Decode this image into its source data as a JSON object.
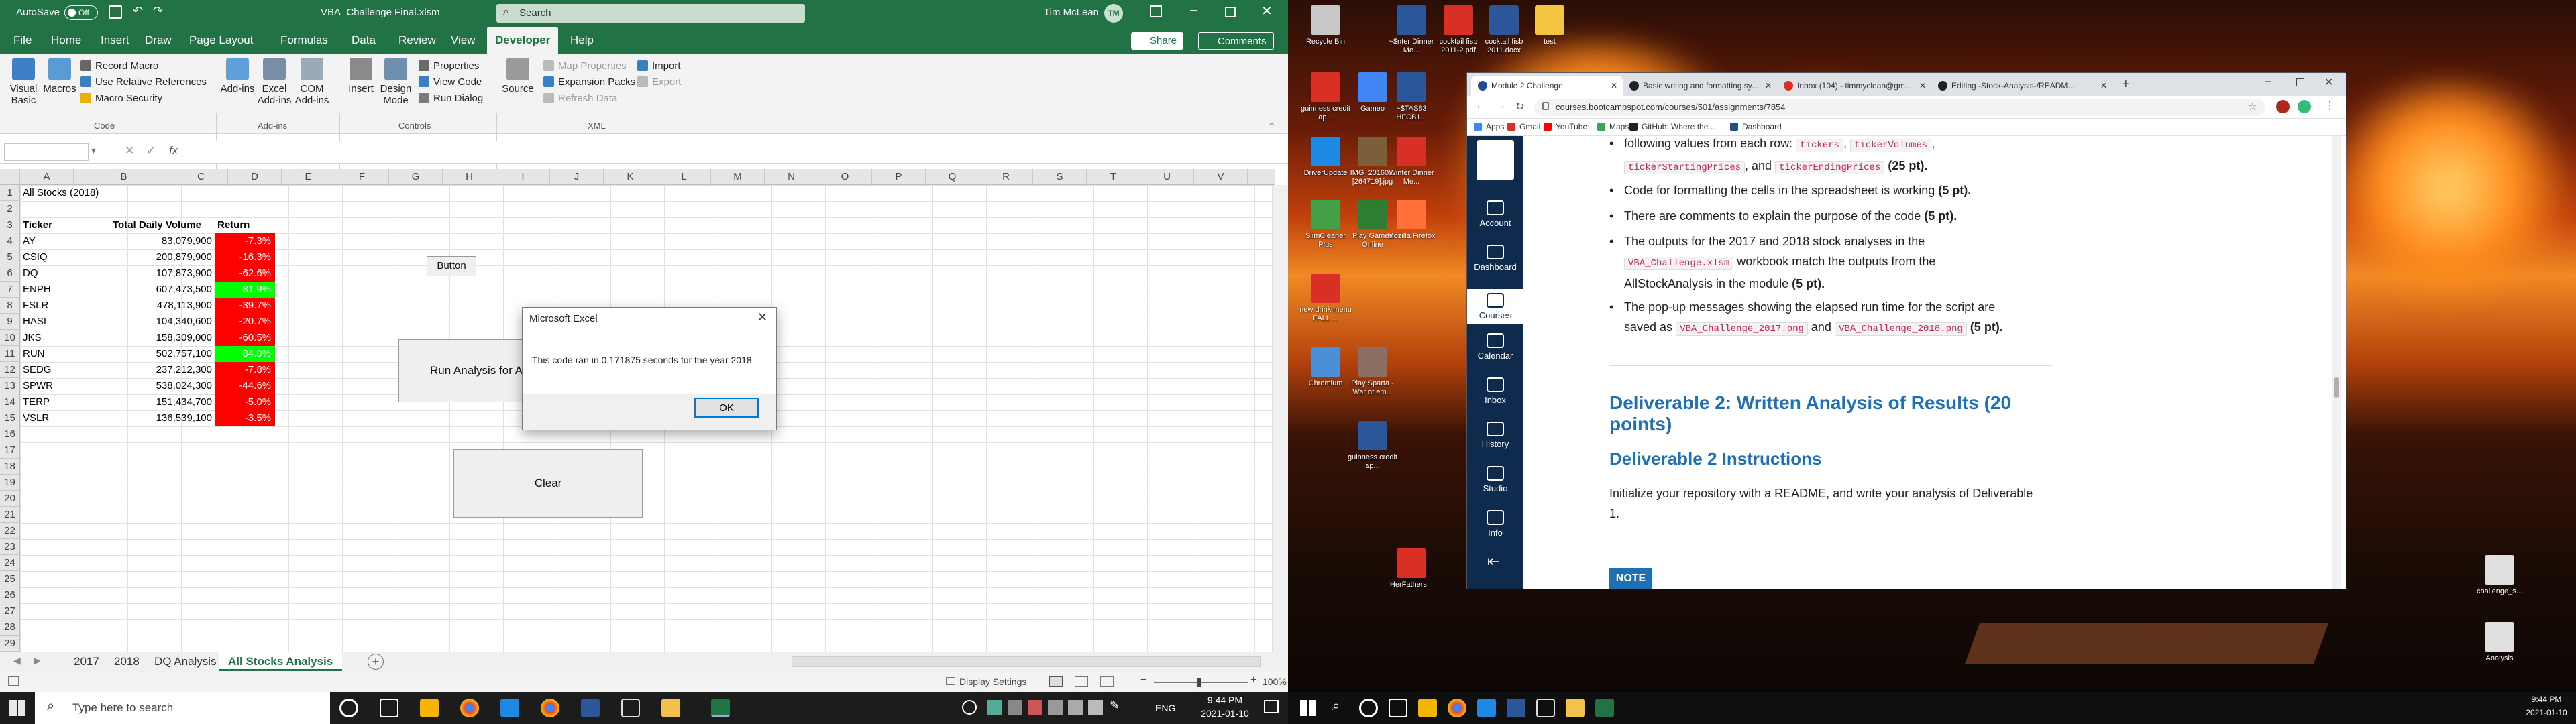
{
  "excel": {
    "autosave_label": "AutoSave",
    "autosave_state": "Off",
    "filename": "VBA_Challenge Final.xlsm",
    "search_placeholder": "Search",
    "user_name": "Tim McLean",
    "user_initials": "TM",
    "tabs": [
      "File",
      "Home",
      "Insert",
      "Draw",
      "Page Layout",
      "Formulas",
      "Data",
      "Review",
      "View",
      "Developer",
      "Help"
    ],
    "active_tab": "Developer",
    "share_label": "Share",
    "comments_label": "Comments",
    "ribbon": {
      "visual_basic": "Visual Basic",
      "macros": "Macros",
      "record_macro": "Record Macro",
      "relative_refs": "Use Relative References",
      "macro_security": "Macro Security",
      "code_group": "Code",
      "addins": "Add-ins",
      "excel_addins": "Excel Add-ins",
      "com_addins": "COM Add-ins",
      "addins_group": "Add-ins",
      "insert": "Insert",
      "design_mode": "Design Mode",
      "properties": "Properties",
      "view_code": "View Code",
      "run_dialog": "Run Dialog",
      "controls_group": "Controls",
      "source": "Source",
      "map_properties": "Map Properties",
      "expansion_packs": "Expansion Packs",
      "refresh_data": "Refresh Data",
      "import": "Import",
      "export": "Export",
      "xml_group": "XML"
    },
    "name_box": "",
    "fx": "fx",
    "columns": [
      "A",
      "B",
      "C",
      "D",
      "E",
      "F",
      "G",
      "H",
      "I",
      "J",
      "K",
      "L",
      "M",
      "N",
      "O",
      "P",
      "Q",
      "R",
      "S",
      "T",
      "U",
      "V"
    ],
    "rows": [
      "1",
      "2",
      "3",
      "4",
      "5",
      "6",
      "7",
      "8",
      "9",
      "10",
      "11",
      "12",
      "13",
      "14",
      "15",
      "16",
      "17",
      "18",
      "19",
      "20",
      "21",
      "22",
      "23",
      "24",
      "25",
      "26",
      "27",
      "28",
      "29"
    ],
    "a1": "All Stocks (2018)",
    "headers": {
      "ticker": "Ticker",
      "volume": "Total Daily Volume",
      "return": "Return"
    },
    "stocks": [
      {
        "ticker": "AY",
        "volume": "83,079,900",
        "ret": "-7.3%",
        "up": false
      },
      {
        "ticker": "CSIQ",
        "volume": "200,879,900",
        "ret": "-16.3%",
        "up": false
      },
      {
        "ticker": "DQ",
        "volume": "107,873,900",
        "ret": "-62.6%",
        "up": false
      },
      {
        "ticker": "ENPH",
        "volume": "607,473,500",
        "ret": "81.9%",
        "up": true
      },
      {
        "ticker": "FSLR",
        "volume": "478,113,900",
        "ret": "-39.7%",
        "up": false
      },
      {
        "ticker": "HASI",
        "volume": "104,340,600",
        "ret": "-20.7%",
        "up": false
      },
      {
        "ticker": "JKS",
        "volume": "158,309,000",
        "ret": "-60.5%",
        "up": false
      },
      {
        "ticker": "RUN",
        "volume": "502,757,100",
        "ret": "84.0%",
        "up": true
      },
      {
        "ticker": "SEDG",
        "volume": "237,212,300",
        "ret": "-7.8%",
        "up": false
      },
      {
        "ticker": "SPWR",
        "volume": "538,024,300",
        "ret": "-44.6%",
        "up": false
      },
      {
        "ticker": "TERP",
        "volume": "151,434,700",
        "ret": "-5.0%",
        "up": false
      },
      {
        "ticker": "VSLR",
        "volume": "136,539,100",
        "ret": "-3.5%",
        "up": false
      }
    ],
    "small_button": "Button",
    "run_button": "Run Analysis for All",
    "clear_button": "Clear",
    "dialog": {
      "title": "Microsoft Excel",
      "message": "This code ran in 0.171875 seconds for the year 2018",
      "ok": "OK"
    },
    "sheets": [
      "2017",
      "2018",
      "DQ Analysis",
      "All Stocks Analysis"
    ],
    "active_sheet": "All Stocks Analysis",
    "display_settings": "Display Settings",
    "zoom": "100%"
  },
  "taskbar_left": {
    "search_placeholder": "Type here to search",
    "lang": "ENG",
    "time": "9:44 PM",
    "date": "2021-01-10"
  },
  "taskbar_right": {
    "time": "9:44 PM",
    "date": "2021-01-10"
  },
  "desktop_icons": [
    {
      "label": "Recycle Bin",
      "color": "#c8c8c8"
    },
    {
      "label": "guinness credit ap...",
      "color": "#d93025"
    },
    {
      "label": "DriverUpdate",
      "color": "#1e88e5"
    },
    {
      "label": "SlimCleaner Plus",
      "color": "#43a047"
    },
    {
      "label": "new drink menu FALL ...",
      "color": "#d93025"
    },
    {
      "label": "Chromium",
      "color": "#4a90d9"
    },
    {
      "label": "Gameo",
      "color": "#4285f4"
    },
    {
      "label": "IMG_20160... [264719].jpg",
      "color": "#7b5e3a"
    },
    {
      "label": "Play Games Online",
      "color": "#2e7d32"
    },
    {
      "label": "Play Sparta - War of em...",
      "color": "#8d6e63"
    },
    {
      "label": "guinness credit ap...",
      "color": "#2b579a"
    },
    {
      "label": "~$nter Dinner Me...",
      "color": "#2b579a"
    },
    {
      "label": "~$TAS83 HFCB1...",
      "color": "#2b579a"
    },
    {
      "label": "Winter Dinner Me...",
      "color": "#d93025"
    },
    {
      "label": "Mozilla Firefox",
      "color": "#ff7139"
    },
    {
      "label": "HerFathers...",
      "color": "#d93025"
    },
    {
      "label": "cocktail fisb 2011-2.pdf",
      "color": "#d93025"
    },
    {
      "label": "cocktail fisb 2011.docx",
      "color": "#2b579a"
    },
    {
      "label": "test",
      "color": "#f4c542"
    },
    {
      "label": "challenge_s...",
      "color": "#e0e0e0"
    },
    {
      "label": "Analysis",
      "color": "#e0e0e0"
    }
  ],
  "chrome": {
    "tabs": [
      "Module 2 Challenge",
      "Basic writing and formatting sy...",
      "Inbox (104) - timmyclean@gm...",
      "Editing -Stock-Analysis-/READM..."
    ],
    "url": "courses.bootcampspot.com/courses/501/assignments/7854",
    "bookmarks": [
      "Apps",
      "Gmail",
      "YouTube",
      "Maps",
      "GitHub: Where the...",
      "Dashboard"
    ],
    "sidebar": [
      "Account",
      "Dashboard",
      "Courses",
      "Calendar",
      "Inbox",
      "History",
      "Studio",
      "Info"
    ],
    "line1_prefix": "following values from each row:",
    "code_tickers": "tickers",
    "code_volumes": "tickerVolumes",
    "code_start": "tickerStartingPrices",
    "code_end": "tickerEndingPrices",
    "and": ", and",
    "pts25": "(25 pt).",
    "bullet_formatting": "Code for formatting the cells in the spreadsheet is working",
    "pts5": "(5 pt).",
    "bullet_comments": "There are comments to explain the purpose of the code",
    "bullet_outputs_a": "The outputs for the 2017 and 2018 stock analyses in the",
    "code_xlsm": "VBA_Challenge.xlsm",
    "bullet_outputs_b": "workbook match the outputs from the",
    "bullet_outputs_c": "AllStockAnalysis in the module",
    "bullet_popup_a": "The pop-up messages showing the elapsed run time for the script are",
    "bullet_popup_b": "saved as",
    "code_png17": "VBA_Challenge_2017.png",
    "code_png18": "VBA_Challenge_2018.png",
    "deliverable2": "Deliverable 2: Written Analysis of Results (20 points)",
    "instructions": "Deliverable 2 Instructions",
    "readme": "Initialize your repository with a README, and write your analysis of Deliverable 1.",
    "note": "NOTE"
  },
  "colors": {
    "excel_green": "#217346",
    "neg": "#ff0000",
    "pos": "#00ff00",
    "canvas_nav": "#0e2a4c",
    "heading": "#1f6fb5"
  }
}
